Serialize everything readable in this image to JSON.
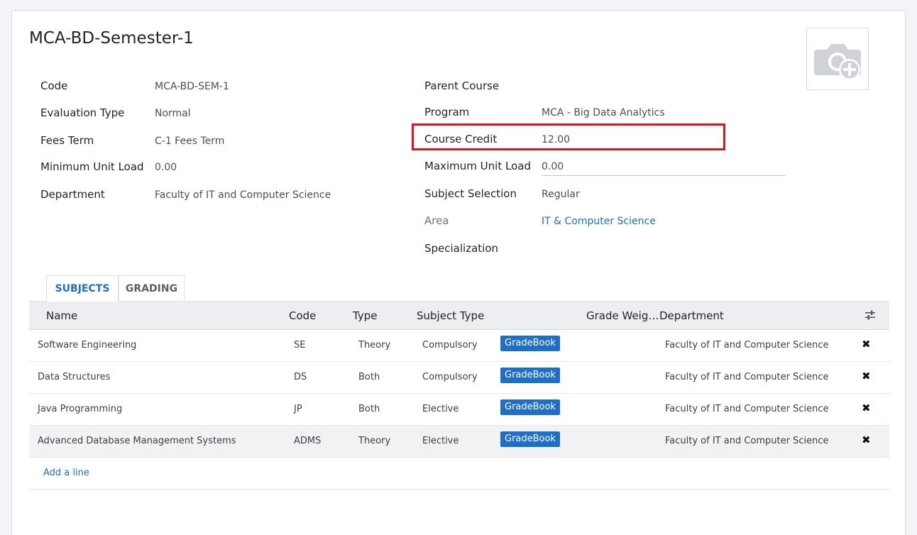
{
  "record": {
    "title": "MCA-BD-Semester-1"
  },
  "left_fields": [
    {
      "label": "Code",
      "value": "MCA-BD-SEM-1"
    },
    {
      "label": "Evaluation Type",
      "value": "Normal"
    },
    {
      "label": "Fees Term",
      "value": "C-1 Fees Term"
    },
    {
      "label": "Minimum Unit Load",
      "value": "0.00"
    },
    {
      "label": "Department",
      "value": "Faculty of IT and Computer Science"
    }
  ],
  "right_fields": [
    {
      "label": "Parent Course",
      "value": ""
    },
    {
      "label": "Program",
      "value": "MCA - Big Data Analytics"
    },
    {
      "label": "Course Credit",
      "value": "12.00"
    },
    {
      "label": "Maximum Unit Load",
      "value": "0.00"
    },
    {
      "label": "Subject Selection",
      "value": "Regular"
    },
    {
      "label": "Area",
      "value": "IT & Computer Science"
    },
    {
      "label": "Specialization",
      "value": ""
    }
  ],
  "tabs": [
    {
      "label": "SUBJECTS",
      "active": true
    },
    {
      "label": "GRADING",
      "active": false
    }
  ],
  "subjects": {
    "columns": [
      "Name",
      "Code",
      "Type",
      "Subject Type",
      "Grade Weig…",
      "Department"
    ],
    "rows": [
      {
        "name": "Software Engineering",
        "code": "SE",
        "type": "Theory",
        "subject_type": "Compulsory",
        "button": "GradeBook",
        "department": "Faculty of IT and Computer Science"
      },
      {
        "name": "Data Structures",
        "code": "DS",
        "type": "Both",
        "subject_type": "Compulsory",
        "button": "GradeBook",
        "department": "Faculty of IT and Computer Science"
      },
      {
        "name": "Java Programming",
        "code": "JP",
        "type": "Both",
        "subject_type": "Elective",
        "button": "GradeBook",
        "department": "Faculty of IT and Computer Science"
      },
      {
        "name": "Advanced Database Management Systems",
        "code": "ADMS",
        "type": "Theory",
        "subject_type": "Elective",
        "button": "GradeBook",
        "department": "Faculty of IT and Computer Science"
      }
    ],
    "add_line": "Add a line"
  },
  "colors": {
    "accent": "#1f6fc5",
    "highlight": "#e0151b"
  },
  "icons": [
    "camera-add-icon",
    "column-options-icon",
    "delete-row-icon"
  ]
}
